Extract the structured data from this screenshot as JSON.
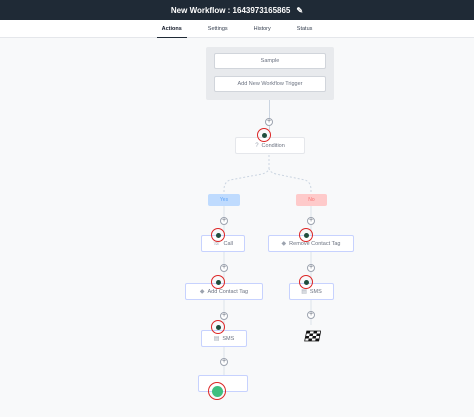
{
  "header": {
    "title": "New Workflow : 1643973165865",
    "edit_icon": "pencil-icon"
  },
  "tabs": [
    {
      "label": "Actions",
      "active": true
    },
    {
      "label": "Settings",
      "active": false
    },
    {
      "label": "History",
      "active": false
    },
    {
      "label": "Status",
      "active": false
    }
  ],
  "trigger": {
    "sample": "Sample",
    "add_trigger": "Add New Workflow Trigger"
  },
  "condition": {
    "label": "Condition",
    "icon": "question-circle-icon"
  },
  "branches": {
    "yes": "Yes",
    "no": "No"
  },
  "yes_path": [
    {
      "label": "Call",
      "icon": "phone-icon"
    },
    {
      "label": "Add Contact Tag",
      "icon": "tag-icon"
    },
    {
      "label": "SMS",
      "icon": "chat-icon"
    },
    {
      "label": "",
      "icon": ""
    }
  ],
  "no_path": [
    {
      "label": "Remove Contact Tag",
      "icon": "tag-icon"
    },
    {
      "label": "SMS",
      "icon": "chat-icon"
    }
  ],
  "end_icon": "checkered-flag-icon",
  "colors": {
    "highlight": "#dc2626",
    "yes": "#bfdbfe",
    "no": "#fecaca",
    "topbar": "#1f2a36"
  }
}
